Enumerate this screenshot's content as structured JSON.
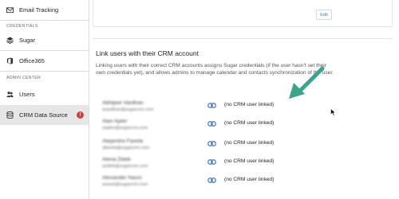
{
  "sidebar": {
    "items_top": [
      {
        "label": "Email Tracking",
        "icon": "envelope-icon"
      }
    ],
    "section_credentials": "CREDENTIALS",
    "credential_items": [
      {
        "label": "Sugar",
        "icon": "layers-icon"
      },
      {
        "label": "Office365",
        "icon": "office-icon"
      }
    ],
    "section_admin": "ADMIN CENTER",
    "admin_items": [
      {
        "label": "Users",
        "icon": "users-icon"
      },
      {
        "label": "CRM Data Source",
        "icon": "database-icon",
        "alert": "!"
      }
    ]
  },
  "top_card": {
    "edit_label": "Edit"
  },
  "panel": {
    "title": "Link users with their CRM account",
    "description": "Linking users with their correct CRM accounts assigns Sugar credentials (if the user hasn't set their own credentials yet), and allows admins to manage calendar and contacts synchronization of the user."
  },
  "users": [
    {
      "name": "Abhijeet Vardhan",
      "email": "avardhan@sugarcrm.com",
      "status": "(no CRM user linked)"
    },
    {
      "name": "Alan Apter",
      "email": "aapter@sugarcrm.com",
      "status": "(no CRM user linked)"
    },
    {
      "name": "Alejandra Favela",
      "email": "afavela@sugarcrm.com",
      "status": "(no CRM user linked)"
    },
    {
      "name": "Alena Zidek",
      "email": "azidek@sugarcrm.com",
      "status": "(no CRM user linked)"
    },
    {
      "name": "Alexander Nassi",
      "email": "anassi@sugarcrm.com",
      "status": "(no CRM user linked)"
    }
  ],
  "colors": {
    "accent": "#3f74c8",
    "alert": "#d83b3b",
    "annotation_arrow": "#3aa58a",
    "active_bg": "#e6e6e6"
  }
}
